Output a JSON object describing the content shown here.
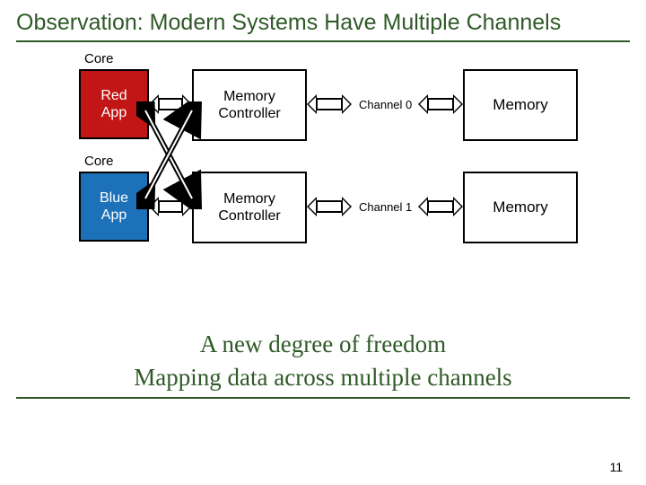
{
  "title": "Observation: Modern Systems Have Multiple Channels",
  "rows": [
    {
      "core_label": "Core",
      "app_label": "Red\nApp",
      "app_color": "#c21616",
      "mc_label": "Memory\nController",
      "channel_label": "Channel 0",
      "mem_label": "Memory"
    },
    {
      "core_label": "Core",
      "app_label": "Blue\nApp",
      "app_color": "#1d71b8",
      "mc_label": "Memory\nController",
      "channel_label": "Channel 1",
      "mem_label": "Memory"
    }
  ],
  "caption": "A new degree of freedom\nMapping data across multiple channels",
  "page_number": "11"
}
